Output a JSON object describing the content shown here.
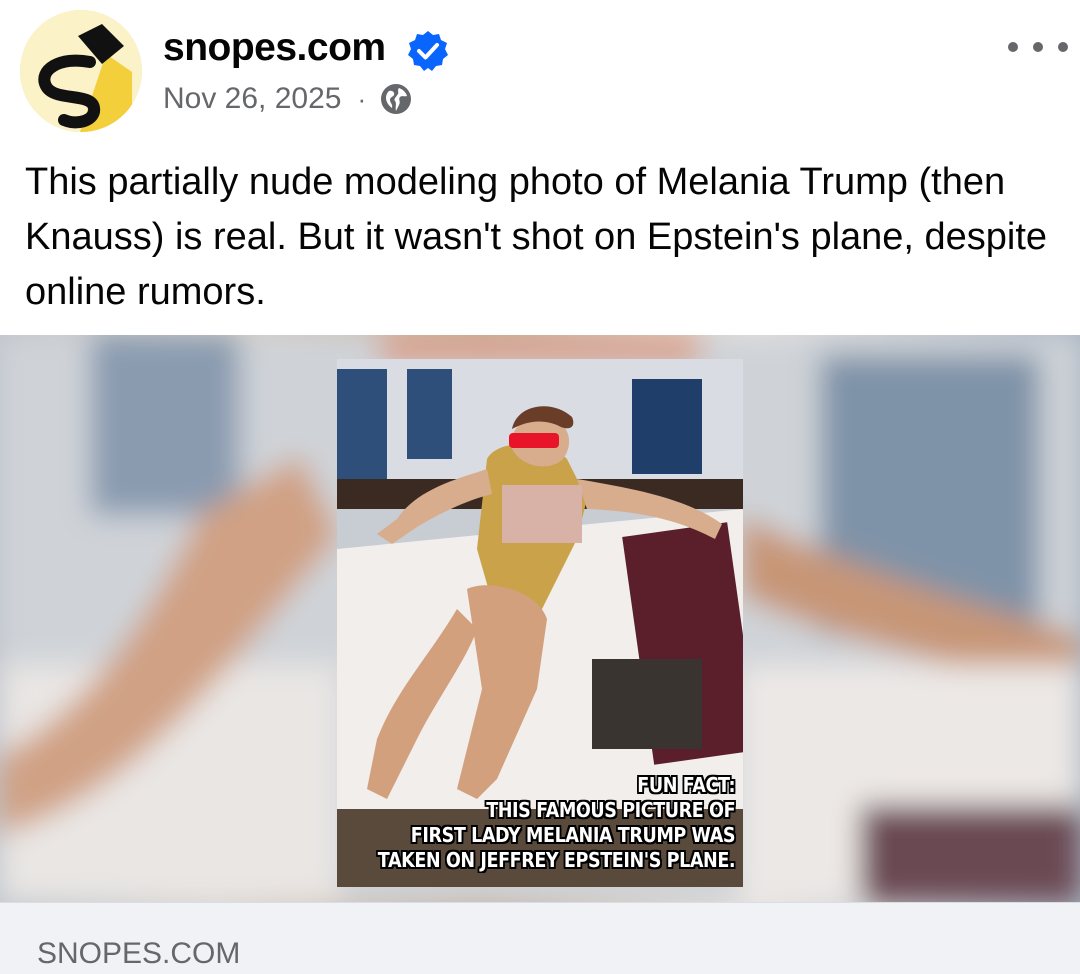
{
  "post": {
    "page_name": "snopes.com",
    "verified": true,
    "date": "Nov 26, 2025",
    "separator": "·",
    "audience_icon": "globe-icon",
    "more_icon": "more-options-icon",
    "caption": "This partially nude modeling photo of Melania Trump (then Knauss) is real. But it wasn't shot on Epstein's plane, despite online rumors."
  },
  "media": {
    "overlay_lines": [
      "FUN FACT:",
      "THIS FAMOUS PICTURE OF",
      "FIRST LADY MELANIA TRUMP WAS",
      "TAKEN ON JEFFREY EPSTEIN'S PLANE."
    ]
  },
  "link_preview": {
    "domain": "SNOPES.COM"
  },
  "colors": {
    "verified_badge": "#0866ff",
    "secondary_text": "#65676b",
    "link_bar_bg": "#f0f2f5"
  }
}
